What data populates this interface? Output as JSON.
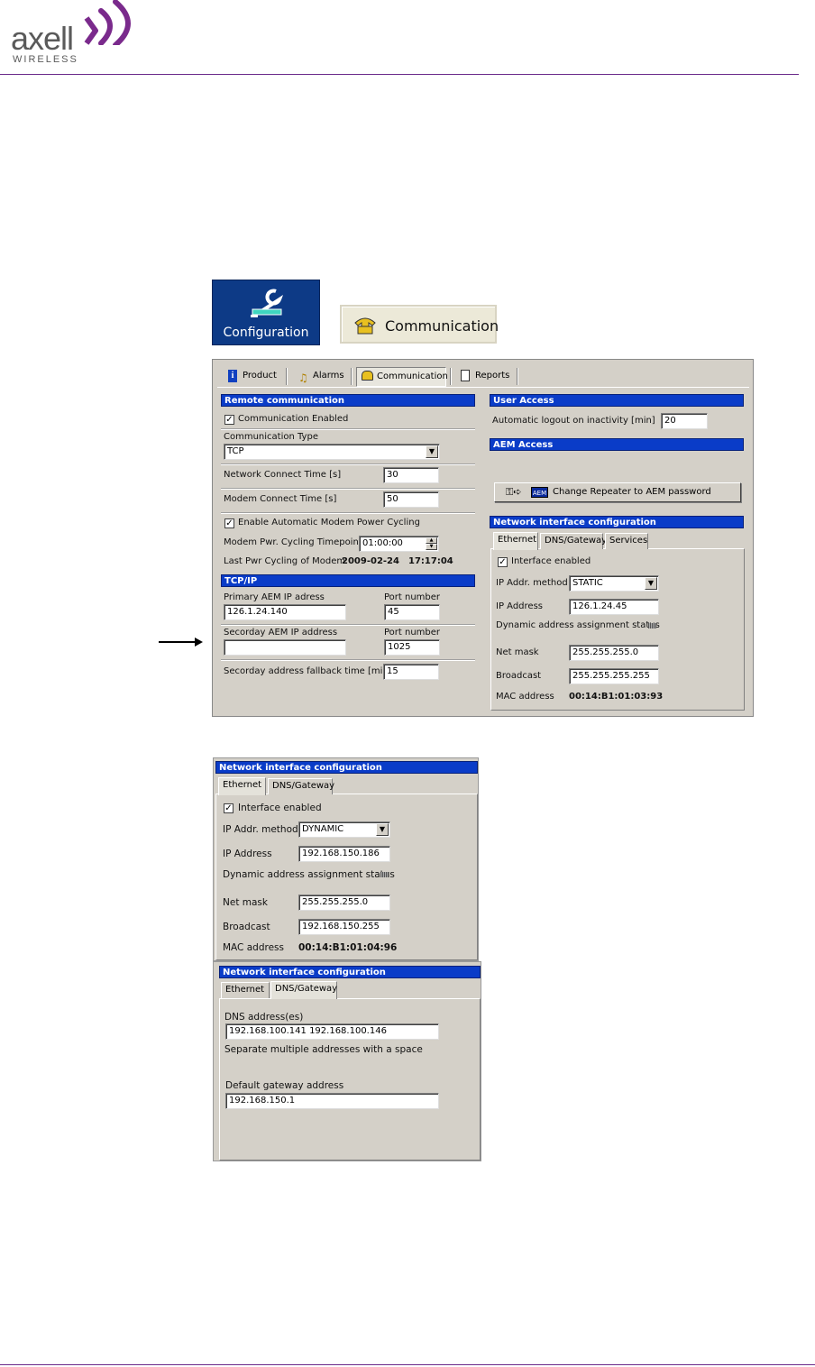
{
  "header": {
    "logo_main": "axell",
    "logo_sub": "WIRELESS"
  },
  "icons": {
    "configuration_label": "Configuration",
    "communication_label": "Communication"
  },
  "toolbar": {
    "tabs": [
      "Product",
      "Alarms",
      "Communication",
      "Reports"
    ]
  },
  "remote": {
    "title": "Remote communication",
    "comm_enabled": "Communication Enabled",
    "comm_type_label": "Communication Type",
    "comm_type_value": "TCP",
    "net_connect_label": "Network Connect Time [s]",
    "net_connect_value": "30",
    "modem_connect_label": "Modem Connect Time [s]",
    "modem_connect_value": "50",
    "auto_cycling": "Enable Automatic Modem Power Cycling",
    "cycling_timepoint_label": "Modem Pwr. Cycling Timepoint",
    "cycling_timepoint_value": "01:00:00",
    "last_cycling_label": "Last Pwr Cycling of Modem",
    "last_cycling_date": "2009-02-24",
    "last_cycling_time": "17:17:04"
  },
  "tcpip": {
    "title": "TCP/IP",
    "primary_label": "Primary AEM IP adress",
    "primary_value": "126.1.24.140",
    "port_label": "Port number",
    "primary_port": "45",
    "secondary_label": "Secorday AEM IP address",
    "secondary_value": "",
    "secondary_port": "1025",
    "fallback_label": "Secorday address fallback time [min]",
    "fallback_value": "15"
  },
  "user_access": {
    "title": "User Access",
    "logout_label": "Automatic logout on inactivity [min]",
    "logout_value": "20"
  },
  "aem_access": {
    "title": "AEM Access",
    "button_label": "Change Repeater to AEM password",
    "aem_badge": "AEM"
  },
  "net1": {
    "title": "Network interface configuration",
    "tabs": [
      "Ethernet",
      "DNS/Gateway",
      "Services"
    ],
    "interface_enabled": "Interface enabled",
    "method_label": "IP Addr. method",
    "method_value": "STATIC",
    "ip_label": "IP Address",
    "ip_value": "126.1.24.45",
    "dyn_status_label": "Dynamic address assignment status",
    "netmask_label": "Net mask",
    "netmask_value": "255.255.255.0",
    "broadcast_label": "Broadcast",
    "broadcast_value": "255.255.255.255",
    "mac_label": "MAC address",
    "mac_value": "00:14:B1:01:03:93"
  },
  "net2": {
    "title": "Network interface configuration",
    "tabs": [
      "Ethernet",
      "DNS/Gateway"
    ],
    "interface_enabled": "Interface enabled",
    "method_label": "IP Addr. method",
    "method_value": "DYNAMIC",
    "ip_label": "IP Address",
    "ip_value": "192.168.150.186",
    "dyn_status_label": "Dynamic address assignment status",
    "netmask_label": "Net mask",
    "netmask_value": "255.255.255.0",
    "broadcast_label": "Broadcast",
    "broadcast_value": "192.168.150.255",
    "mac_label": "MAC address",
    "mac_value": "00:14:B1:01:04:96"
  },
  "net3": {
    "title": "Network interface configuration",
    "tabs": [
      "Ethernet",
      "DNS/Gateway"
    ],
    "dns_label": "DNS address(es)",
    "dns_value": "192.168.100.141 192.168.100.146",
    "dns_hint": "Separate multiple addresses with a space",
    "gateway_label": "Default gateway address",
    "gateway_value": "192.168.150.1"
  }
}
